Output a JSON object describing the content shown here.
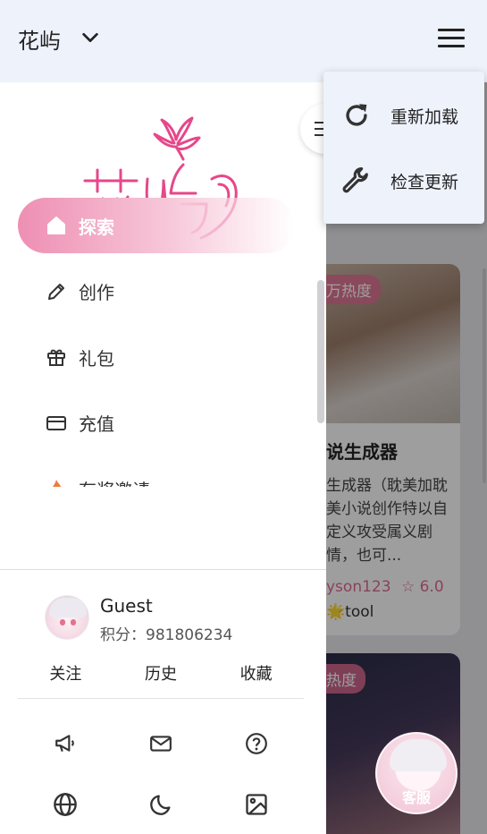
{
  "header": {
    "app_title": "花屿",
    "chevron_icon": "chevron-down-icon",
    "menu_icon": "hamburger-menu-icon"
  },
  "popup_menu": {
    "items": [
      {
        "label": "重新加载",
        "icon": "refresh-icon"
      },
      {
        "label": "检查更新",
        "icon": "wrench-icon"
      }
    ]
  },
  "drawer": {
    "logo_text": "花屿",
    "nav": [
      {
        "label": "探索",
        "icon": "home-icon",
        "active": true
      },
      {
        "label": "创作",
        "icon": "pencil-icon",
        "active": false
      },
      {
        "label": "礼包",
        "icon": "gift-icon",
        "active": false
      },
      {
        "label": "充值",
        "icon": "card-icon",
        "active": false
      },
      {
        "label": "有奖邀请",
        "icon": "fire-icon",
        "active": false
      }
    ],
    "user": {
      "name": "Guest",
      "points_label": "积分：",
      "points_value": "981806234"
    },
    "tabs": [
      "关注",
      "历史",
      "收藏"
    ],
    "bottom_icons": [
      [
        "megaphone-icon",
        "mail-icon",
        "help-icon"
      ],
      [
        "globe-icon",
        "moon-icon",
        "image-icon"
      ]
    ]
  },
  "background_cards": [
    {
      "heat_badge": "万热度",
      "title": "说生成器",
      "description": "生成器（耽美加耽美小说创作特以自定义攻受属义剧情，也可...",
      "author": "yson123",
      "rating": "6.0",
      "tag": "🌟tool"
    },
    {
      "heat_badge": "热度"
    }
  ],
  "support_button": {
    "label": "客服"
  },
  "colors": {
    "accent_pink": "#ee8fb3",
    "topbar_bg": "#eef2fb"
  }
}
